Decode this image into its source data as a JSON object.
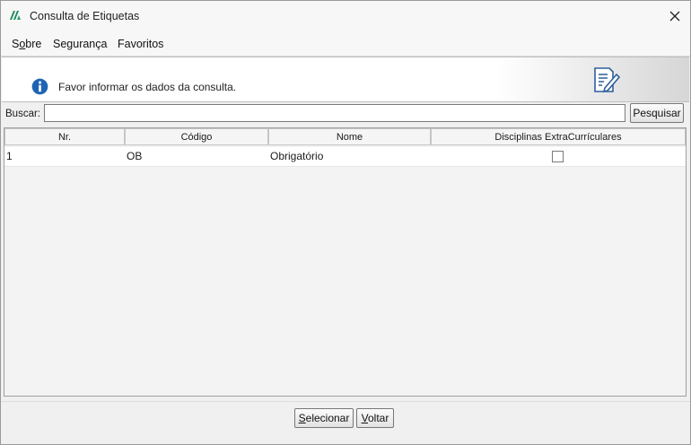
{
  "window": {
    "title": "Consulta de Etiquetas",
    "close_icon": "close-icon",
    "app_icon": "app-logo-icon"
  },
  "menu": {
    "items": [
      {
        "label": "Sobre",
        "mnemonic": "o"
      },
      {
        "label": "Segurança"
      },
      {
        "label": "Favoritos"
      }
    ]
  },
  "info": {
    "message": "Favor informar os dados da consulta.",
    "icon": "info-icon",
    "decor_icon": "document-edit-icon"
  },
  "search": {
    "label": "Buscar:",
    "value": "",
    "button_label": "Pesquisar"
  },
  "table": {
    "columns": [
      "Nr.",
      "Código",
      "Nome",
      "Disciplinas ExtraCurrículares"
    ],
    "rows": [
      {
        "nr": "1",
        "codigo": "OB",
        "nome": "Obrigatório",
        "extracurricular": false
      }
    ]
  },
  "footer": {
    "select_label": "Selecionar",
    "back_label": "Voltar"
  },
  "colors": {
    "info_blue": "#1e64b4",
    "window_bg": "#f0f0f0"
  }
}
